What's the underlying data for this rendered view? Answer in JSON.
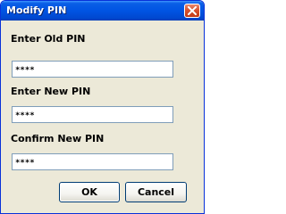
{
  "window": {
    "title": "Modify PIN"
  },
  "fields": [
    {
      "label": "Enter Old PIN",
      "value": "****"
    },
    {
      "label": "Enter New PIN",
      "value": "****"
    },
    {
      "label": "Confirm New PIN",
      "value": "****"
    }
  ],
  "buttons": {
    "ok_label": "OK",
    "cancel_label": "Cancel"
  },
  "icons": {
    "close": "close-icon"
  },
  "colors": {
    "titlebar": "#0054e3",
    "window_bg": "#ece9d8",
    "close_button": "#d8532f",
    "input_border": "#7f9db9"
  }
}
